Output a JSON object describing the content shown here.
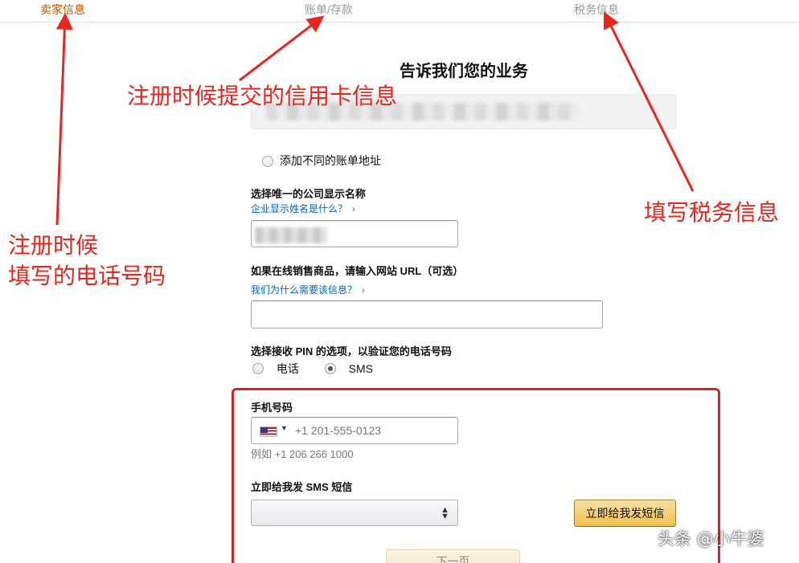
{
  "steps": [
    "卖家信息",
    "账单/存款",
    "税务信息"
  ],
  "page_title": "告诉我们您的业务",
  "alt_billing_label": "添加不同的账单地址",
  "display_name": {
    "label": "选择唯一的公司显示名称",
    "help_link": "企业显示姓名是什么？",
    "help_arrow": "›"
  },
  "website": {
    "label": "如果在线销售商品，请输入网站 URL（可选）",
    "help_link": "我们为什么需要该信息？",
    "help_arrow": "›"
  },
  "pin": {
    "label": "选择接收 PIN 的选项，以验证您的电话号码",
    "options": [
      "电话",
      "SMS"
    ],
    "selected": "SMS"
  },
  "phone": {
    "label": "手机号码",
    "flag_icon": "us-flag-icon",
    "placeholder": "+1 201-555-0123",
    "example": "例如 +1 206 266 1000"
  },
  "sms": {
    "label": "立即给我发 SMS 短信",
    "select_value": "",
    "button": "立即给我发短信"
  },
  "next_button": "下一页",
  "annotations": {
    "credit_card": "注册时候提交的信用卡信息",
    "phone_line1": "注册时候",
    "phone_line2": "填写的电话号码",
    "tax": "填写税务信息"
  },
  "colors": {
    "annotation": "#e8261e",
    "active_step": "#c45500",
    "link": "#0066c0",
    "button": "#f0c14b"
  },
  "watermark": "头条 @小牛婆"
}
